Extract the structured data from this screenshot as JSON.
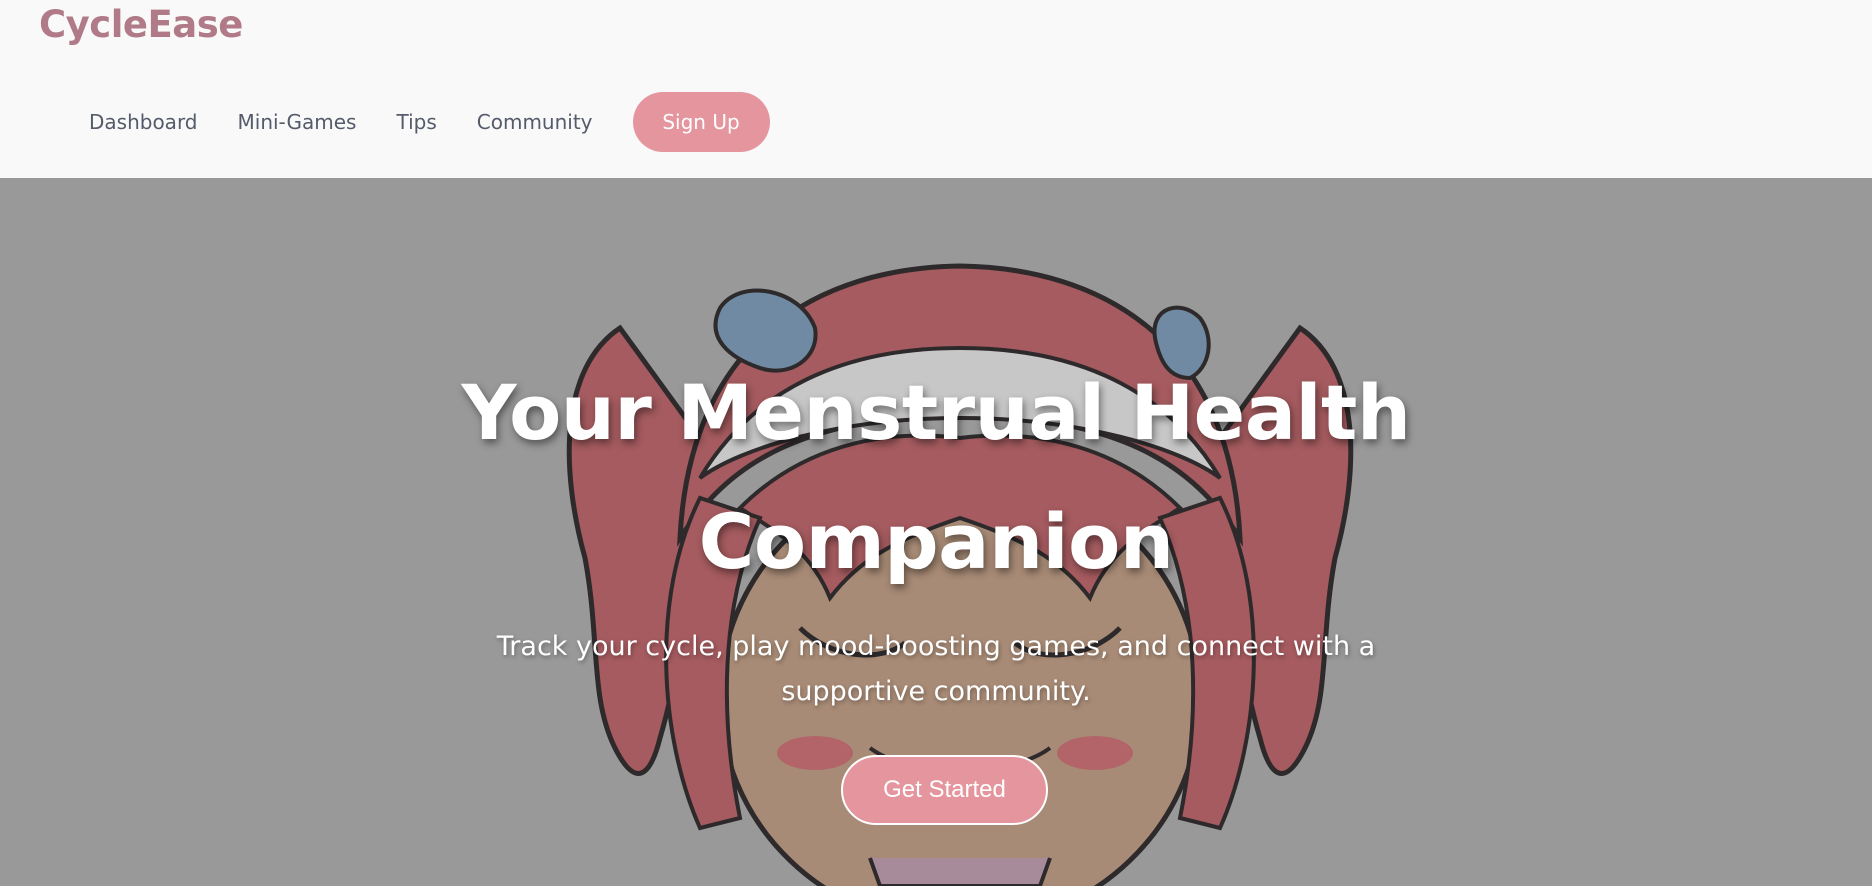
{
  "header": {
    "logo": "CycleEase",
    "nav": {
      "dashboard": "Dashboard",
      "mini_games": "Mini-Games",
      "tips": "Tips",
      "community": "Community",
      "signup": "Sign Up"
    }
  },
  "hero": {
    "title_line1": "Your Menstrual Health",
    "title_line2": "Companion",
    "subtitle_line1": "Track your cycle, play mood-boosting games, and connect with a",
    "subtitle_line2": "supportive community.",
    "cta": "Get Started",
    "image_subject": "chibi-girl-with-pink-pigtails"
  },
  "colors": {
    "brand": "#b07a88",
    "accent": "#e5959d",
    "nav_text": "#555b6a",
    "hero_overlay": "#999999"
  }
}
